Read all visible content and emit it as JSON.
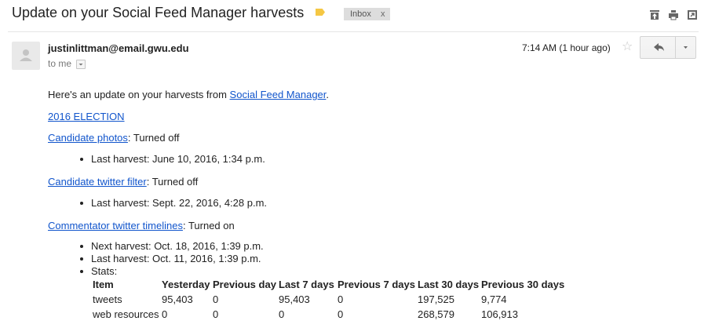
{
  "header": {
    "subject": "Update on your Social Feed Manager harvests",
    "label": "Inbox",
    "label_close": "x",
    "icons": [
      "archive-icon",
      "print-icon",
      "new-window-icon"
    ]
  },
  "message": {
    "sender": "justinlittman@email.gwu.edu",
    "to": "to me",
    "time": "7:14 AM (1 hour ago)"
  },
  "body": {
    "intro_before": "Here's an update on your harvests from ",
    "intro_link": "Social Feed Manager",
    "intro_after": ".",
    "collection": "2016 ELECTION",
    "harvests": [
      {
        "name": "Candidate photos",
        "status": ": Turned off",
        "details": [
          "Last harvest: June 10, 2016, 1:34 p.m."
        ]
      },
      {
        "name": "Candidate twitter filter",
        "status": ": Turned off",
        "details": [
          "Last harvest: Sept. 22, 2016, 4:28 p.m."
        ]
      },
      {
        "name": "Commentator twitter timelines",
        "status": ": Turned on",
        "details": [
          "Next harvest: Oct. 18, 2016, 1:39 p.m.",
          "Last harvest: Oct. 11, 2016, 1:39 p.m.",
          "Stats:"
        ]
      }
    ],
    "stats": {
      "headers": [
        "Item",
        "Yesterday",
        "Previous day",
        "Last 7 days",
        "Previous 7 days",
        "Last 30 days",
        "Previous 30 days"
      ],
      "rows": [
        [
          "tweets",
          "95,403",
          "0",
          "95,403",
          "0",
          "197,525",
          "9,774"
        ],
        [
          "web resources",
          "0",
          "0",
          "0",
          "0",
          "268,579",
          "106,913"
        ]
      ]
    }
  },
  "colors": {
    "link": "#1155cc",
    "label_tag": "#f5c743",
    "chip_bg": "#dddddd"
  }
}
